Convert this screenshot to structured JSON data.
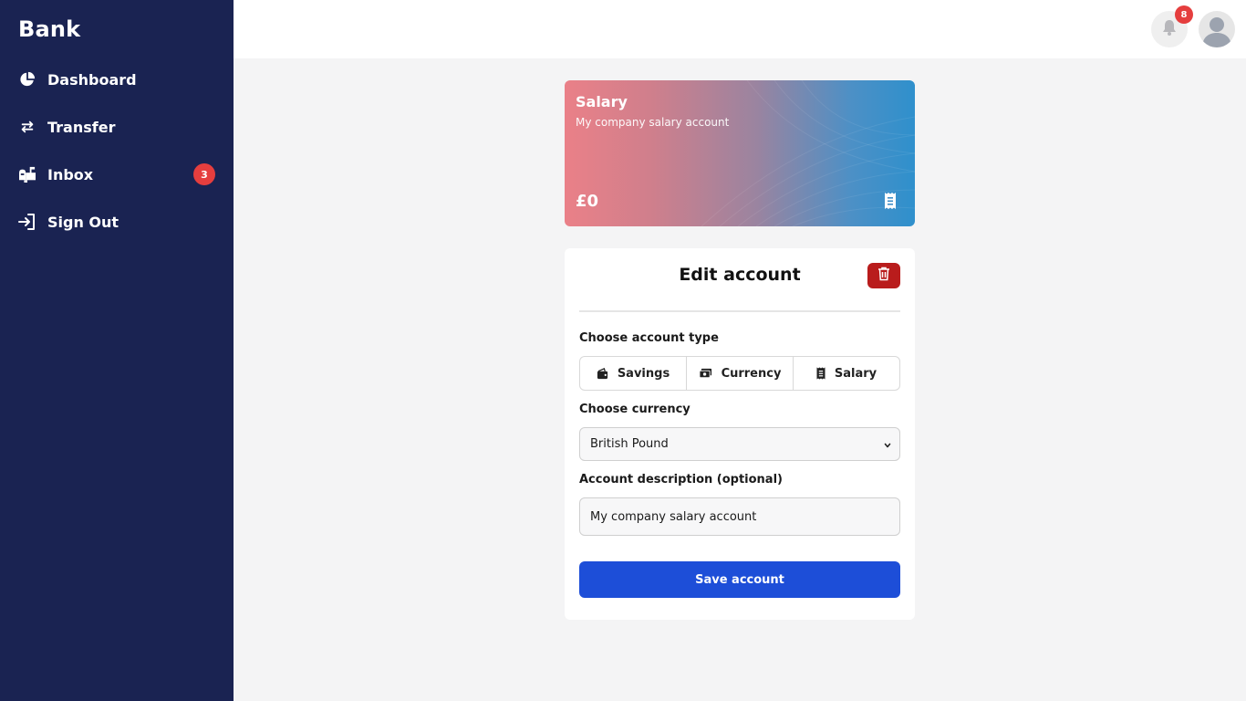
{
  "app": {
    "brand": "Bank"
  },
  "sidebar": {
    "items": [
      {
        "label": "Dashboard",
        "icon": "pie-chart-icon"
      },
      {
        "label": "Transfer",
        "icon": "transfer-arrows-icon"
      },
      {
        "label": "Inbox",
        "icon": "mailbox-icon",
        "badge": "3"
      },
      {
        "label": "Sign Out",
        "icon": "sign-out-icon"
      }
    ]
  },
  "topbar": {
    "notifications_count": "8",
    "icons": [
      "bell-icon",
      "user-avatar-icon"
    ]
  },
  "account_card": {
    "title": "Salary",
    "description": "My company salary account",
    "balance": "£0",
    "icon": "receipt-icon"
  },
  "edit_panel": {
    "title": "Edit account",
    "delete_icon": "trash-icon",
    "account_type_label": "Choose account type",
    "account_types": [
      {
        "label": "Savings",
        "icon": "wallet-icon"
      },
      {
        "label": "Currency",
        "icon": "money-bills-icon"
      },
      {
        "label": "Salary",
        "icon": "receipt-icon"
      }
    ],
    "currency_label": "Choose currency",
    "currency_selected": "British Pound",
    "description_label": "Account description (optional)",
    "description_value": "My company salary account",
    "save_label": "Save account"
  },
  "colors": {
    "sidebar_bg": "#1a2352",
    "primary": "#1d4ed8",
    "danger": "#b91c1c",
    "badge": "#e53e3e",
    "card_gradient_start": "#ea8088",
    "card_gradient_end": "#2f90cc"
  }
}
